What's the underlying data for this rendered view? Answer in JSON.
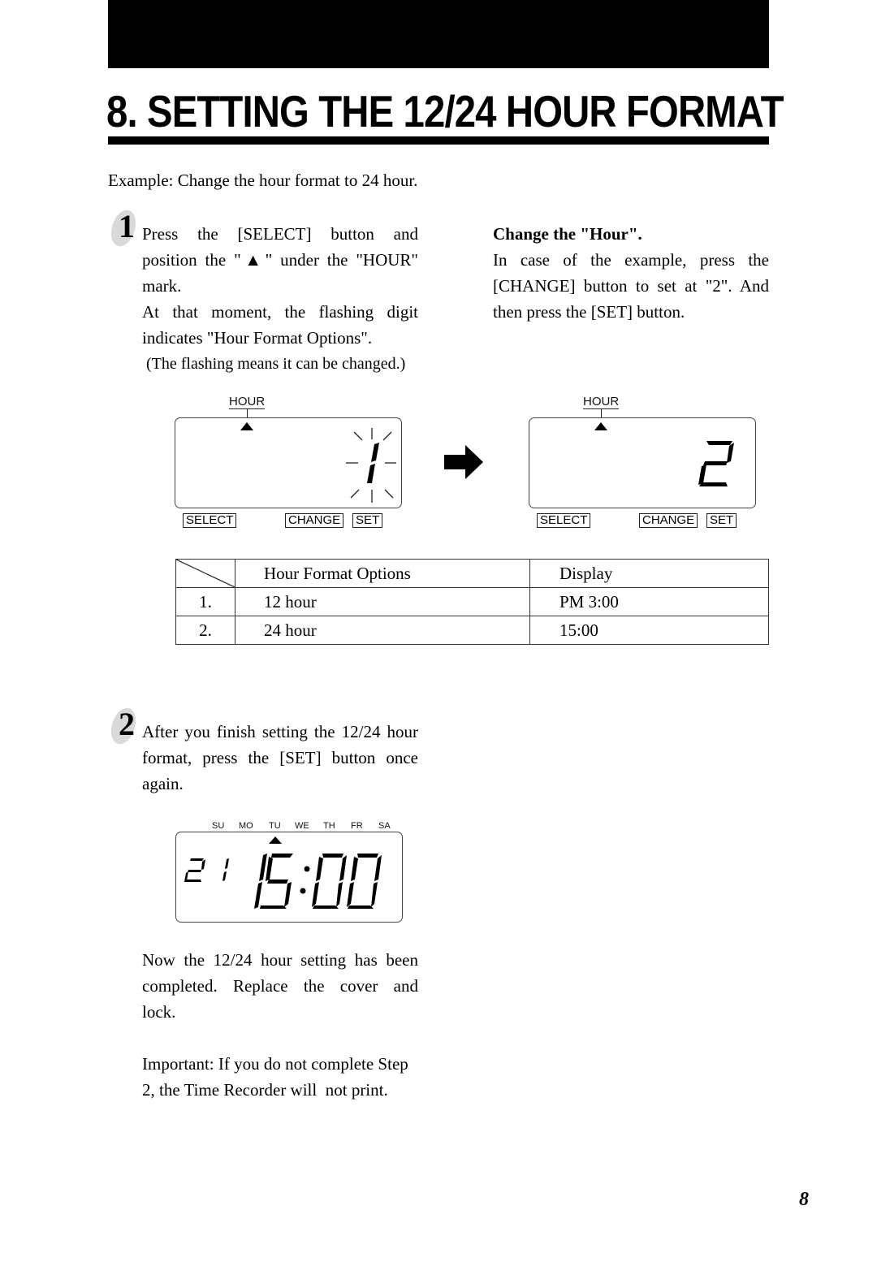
{
  "page": {
    "section_title": "8. SETTING THE 12/24 HOUR FORMAT",
    "example": "Example: Change the hour format to 24 hour.",
    "page_number": "8"
  },
  "step1": {
    "number": "1",
    "lines": [
      "Press the [SELECT] button and",
      "position the \"▲\" under the \"HOUR\"",
      "mark.",
      "At that moment, the flashing digit",
      "indicates \"Hour Format Options\"."
    ],
    "note": "(The flashing means it can be changed.)"
  },
  "change_hour": {
    "heading": "Change the \"Hour\".",
    "lines": [
      "In case of the example, press the",
      "[CHANGE] button to set at \"2\". And",
      "then press the [SET] button."
    ]
  },
  "display_before": {
    "indicator_label": "HOUR",
    "digit": "1",
    "flashing": true,
    "buttons": [
      "SELECT",
      "CHANGE",
      "SET"
    ]
  },
  "display_after": {
    "indicator_label": "HOUR",
    "digit": "2",
    "buttons": [
      "SELECT",
      "CHANGE",
      "SET"
    ]
  },
  "options_table": {
    "headers": [
      "",
      "Hour Format Options",
      "Display"
    ],
    "rows": [
      [
        "1.",
        "12 hour",
        "PM 3:00"
      ],
      [
        "2.",
        "24 hour",
        "15:00"
      ]
    ]
  },
  "step2": {
    "number": "2",
    "lines": [
      "After you finish setting the 12/24 hour",
      "format, press the [SET] button once",
      "again."
    ]
  },
  "final_display": {
    "days": [
      "SU",
      "MO",
      "TU",
      "WE",
      "TH",
      "FR",
      "SA"
    ],
    "active_day": "TU",
    "date": "21",
    "time": "15:00"
  },
  "completion": {
    "lines": [
      "Now the 12/24 hour setting has been",
      "completed. Replace the cover and",
      "lock."
    ]
  },
  "important": {
    "lines": [
      "Important: If you do not complete Step",
      "2, the Time Recorder will  not print."
    ]
  }
}
